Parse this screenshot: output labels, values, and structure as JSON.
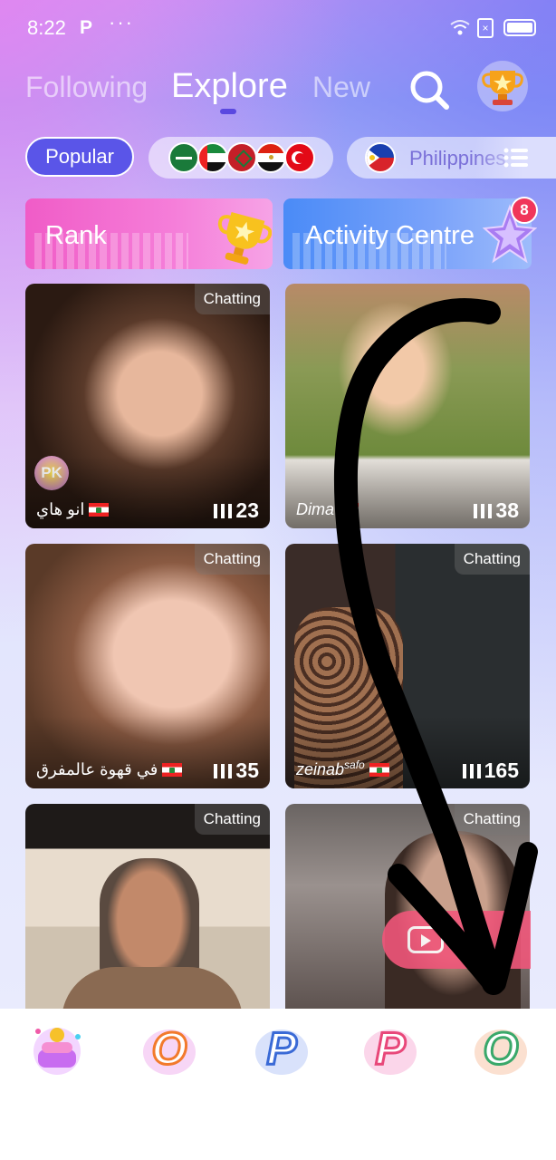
{
  "status_bar": {
    "time": "8:22",
    "app_badge": "P",
    "more": "···"
  },
  "tabs": [
    {
      "label": "Following",
      "active": false
    },
    {
      "label": "Explore",
      "active": true
    },
    {
      "label": "New",
      "active": false
    }
  ],
  "filters": {
    "popular_label": "Popular",
    "region_flags": [
      "Saudi Arabia",
      "UAE",
      "Morocco",
      "Egypt",
      "Turkey"
    ],
    "country_label": "Philippines"
  },
  "banners": {
    "rank_label": "Rank",
    "activity_label": "Activity Centre",
    "activity_badge": "8"
  },
  "rooms": [
    {
      "status": "Chatting",
      "name": "انو هاي",
      "viewers": "23",
      "pk": "PK"
    },
    {
      "status": "",
      "name": "Dima",
      "viewers": "38"
    },
    {
      "status": "Chatting",
      "name": "في قهوة عالمفرق",
      "viewers": "35"
    },
    {
      "status": "Chatting",
      "name": "zeinab",
      "name_suffix": "safo",
      "viewers": "165"
    },
    {
      "status": "Chatting",
      "name": "",
      "viewers": ""
    },
    {
      "status": "Chatting",
      "name": "",
      "viewers": ""
    }
  ],
  "bottom_nav": [
    {
      "icon": "cake-icon",
      "letter": ""
    },
    {
      "icon": "letter-o-icon",
      "letter": "O"
    },
    {
      "icon": "letter-p-icon",
      "letter": "P"
    },
    {
      "icon": "letter-p-icon",
      "letter": "P"
    },
    {
      "icon": "letter-o-icon",
      "letter": "O"
    }
  ],
  "colors": {
    "accent": "#5a55e8",
    "rank_banner": "#f05cc7",
    "activity_banner": "#4a8bf7",
    "badge": "#f0365a",
    "live_button": "#f0567a"
  }
}
